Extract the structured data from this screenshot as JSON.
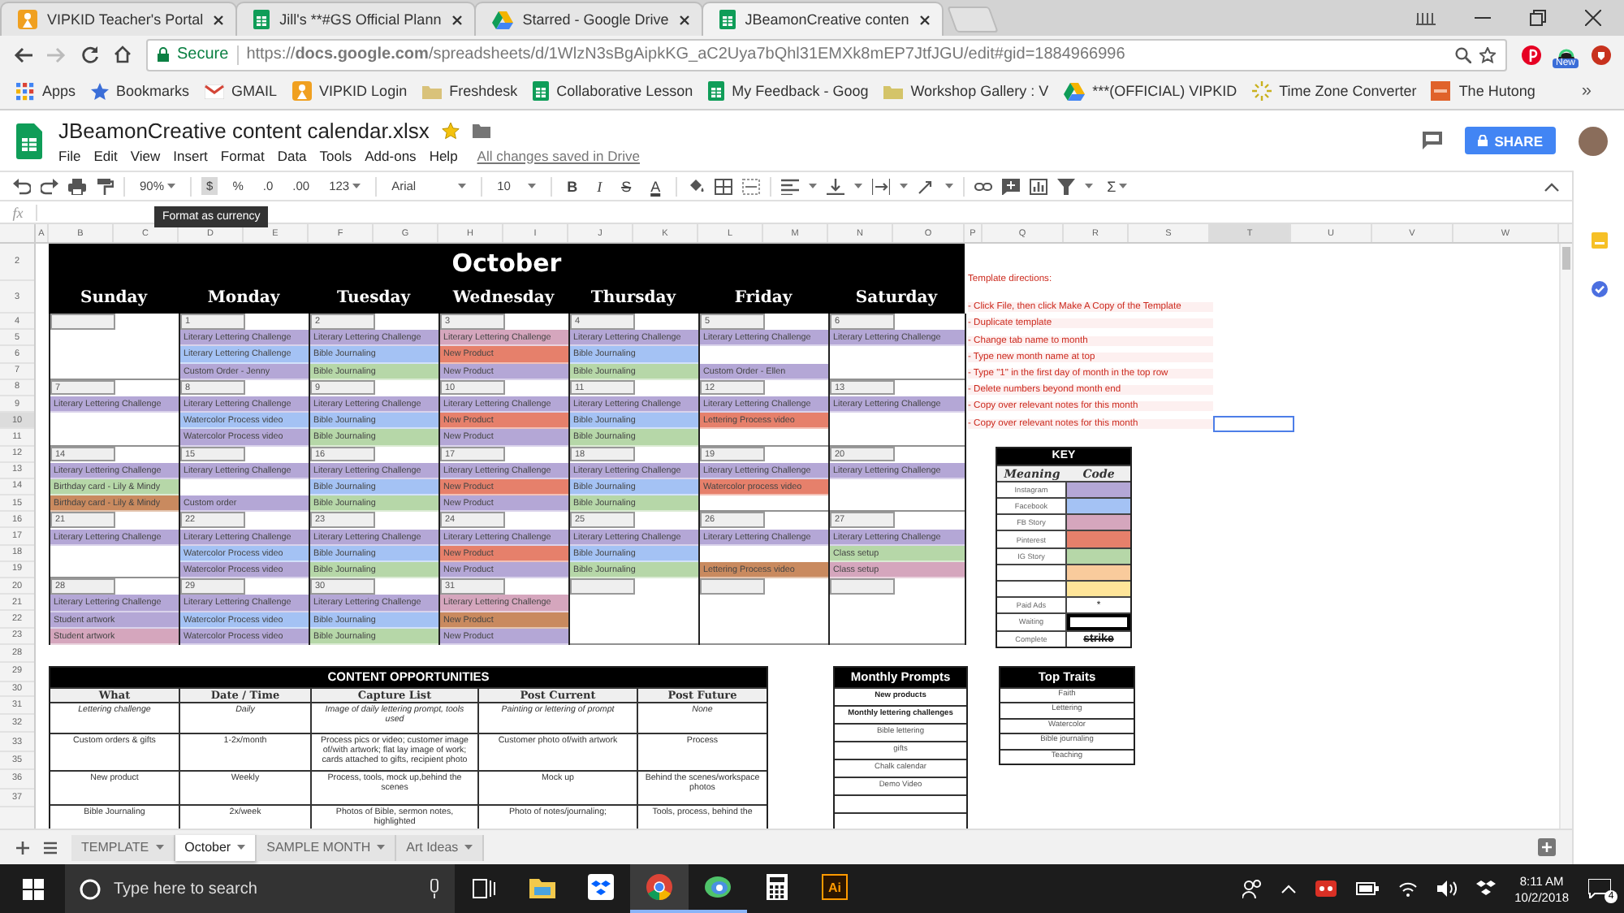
{
  "browser": {
    "tabs": [
      {
        "kind": "vipkid",
        "title": "VIPKID Teacher's Portal",
        "selected": false
      },
      {
        "kind": "sheets",
        "title": "Jill's **#GS Official Plann",
        "selected": false
      },
      {
        "kind": "drive",
        "title": "Starred - Google Drive",
        "selected": false
      },
      {
        "kind": "sheets",
        "title": "JBeamonCreative conten",
        "selected": true
      }
    ],
    "security": "Secure",
    "url": "https://**docs.google.com**/spreadsheets/d/1WlzN3sBgAipkKG_aC2Uya7bQhl31EMXk8mEP7JtfJGU/edit#gid=1884966996",
    "extension_badge": "New",
    "bookmarks": [
      {
        "kind": "apps",
        "label": "Apps"
      },
      {
        "kind": "star",
        "label": "Bookmarks"
      },
      {
        "kind": "gmail",
        "label": "GMAIL"
      },
      {
        "kind": "vipkid",
        "label": "VIPKID Login"
      },
      {
        "kind": "freshdesk",
        "label": "Freshdesk"
      },
      {
        "kind": "sheets",
        "label": "Collaborative Lesson"
      },
      {
        "kind": "sheets",
        "label": "My Feedback - Goog"
      },
      {
        "kind": "folder",
        "label": "Workshop Gallery : V"
      },
      {
        "kind": "drive",
        "label": "***(OFFICIAL) VIPKID"
      },
      {
        "kind": "sun",
        "label": "Time Zone Converter"
      },
      {
        "kind": "hutong",
        "label": "The Hutong"
      }
    ],
    "more_bookmarks": "»"
  },
  "docs": {
    "title": "JBeamonCreative content calendar.xlsx",
    "starred": true,
    "menus": [
      "File",
      "Edit",
      "View",
      "Insert",
      "Format",
      "Data",
      "Tools",
      "Add-ons",
      "Help"
    ],
    "save_status": "All changes saved in Drive",
    "share": "SHARE"
  },
  "toolbar": {
    "zoom": "90%",
    "number_formats": [
      {
        "label": "$",
        "hovered": true
      },
      {
        "label": "%",
        "hovered": false
      },
      {
        "label": ".0",
        "hovered": false
      },
      {
        "label": ".00",
        "hovered": false
      }
    ],
    "more_formats": "123",
    "font": "Arial",
    "font_size": "10",
    "text_styles": [
      "B",
      "I",
      "S",
      "A"
    ],
    "functions": "Σ",
    "tooltip": "Format as currency"
  },
  "formula_bar": {
    "label": "fx"
  },
  "columns": [
    {
      "label": "A",
      "selected": false
    },
    {
      "label": "B",
      "selected": false
    },
    {
      "label": "C",
      "selected": false
    },
    {
      "label": "D",
      "selected": false
    },
    {
      "label": "E",
      "selected": false
    },
    {
      "label": "F",
      "selected": false
    },
    {
      "label": "G",
      "selected": false
    },
    {
      "label": "H",
      "selected": false
    },
    {
      "label": "I",
      "selected": false
    },
    {
      "label": "J",
      "selected": false
    },
    {
      "label": "K",
      "selected": false
    },
    {
      "label": "L",
      "selected": false
    },
    {
      "label": "M",
      "selected": false
    },
    {
      "label": "N",
      "selected": false
    },
    {
      "label": "O",
      "selected": false
    },
    {
      "label": "P",
      "selected": false
    },
    {
      "label": "Q",
      "selected": false
    },
    {
      "label": "R",
      "selected": false
    },
    {
      "label": "S",
      "selected": false
    },
    {
      "label": "T",
      "selected": true
    },
    {
      "label": "U",
      "selected": false
    },
    {
      "label": "V",
      "selected": false
    },
    {
      "label": "W",
      "selected": false
    }
  ],
  "rows": [
    {
      "label": "2",
      "selected": false
    },
    {
      "label": "3",
      "selected": false
    },
    {
      "label": "4",
      "selected": false
    },
    {
      "label": "5",
      "selected": false
    },
    {
      "label": "6",
      "selected": false
    },
    {
      "label": "7",
      "selected": false
    },
    {
      "label": "8",
      "selected": false
    },
    {
      "label": "9",
      "selected": false
    },
    {
      "label": "10",
      "selected": true
    },
    {
      "label": "11",
      "selected": false
    },
    {
      "label": "12",
      "selected": false
    },
    {
      "label": "13",
      "selected": false
    },
    {
      "label": "14",
      "selected": false
    },
    {
      "label": "15",
      "selected": false
    },
    {
      "label": "16",
      "selected": false
    },
    {
      "label": "17",
      "selected": false
    },
    {
      "label": "18",
      "selected": false
    },
    {
      "label": "19",
      "selected": false
    },
    {
      "label": "20",
      "selected": false
    },
    {
      "label": "21",
      "selected": false
    },
    {
      "label": "22",
      "selected": false
    },
    {
      "label": "23",
      "selected": false
    },
    {
      "label": "28",
      "selected": false
    },
    {
      "label": "29",
      "selected": false
    },
    {
      "label": "30",
      "selected": false
    },
    {
      "label": "31",
      "selected": false
    },
    {
      "label": "32",
      "selected": false
    },
    {
      "label": "33",
      "selected": false
    },
    {
      "label": "35",
      "selected": false
    },
    {
      "label": "36",
      "selected": false
    },
    {
      "label": "37",
      "selected": false
    }
  ],
  "calendar": {
    "month": "October",
    "day_names": [
      "Sunday",
      "Monday",
      "Tuesday",
      "Wednesday",
      "Thursday",
      "Friday",
      "Saturday"
    ],
    "weeks": [
      {
        "days": [
          {
            "kind": "blank"
          },
          {
            "date": "1",
            "entries": [
              {
                "text": "Literary Lettering Challenge",
                "color": "#b4a7d6"
              },
              {
                "text": "Literary Lettering Challenge",
                "color": "#a4c2f4"
              },
              {
                "text": "Custom Order - Jenny",
                "color": "#b4a7d6"
              }
            ]
          },
          {
            "date": "2",
            "entries": [
              {
                "text": "Literary Lettering Challenge",
                "color": "#b4a7d6"
              },
              {
                "text": "Bible Journaling",
                "color": "#a4c2f4"
              },
              {
                "text": "Bible Journaling",
                "color": "#b6d7a8"
              }
            ]
          },
          {
            "date": "3",
            "entries": [
              {
                "text": "Literary Lettering Challenge",
                "color": "#d5a6bd"
              },
              {
                "text": "New Product",
                "color": "#e6806b"
              },
              {
                "text": "New Product",
                "color": "#b4a7d6"
              }
            ]
          },
          {
            "date": "4",
            "entries": [
              {
                "text": "Literary Lettering Challenge",
                "color": "#b4a7d6"
              },
              {
                "text": "Bible Journaling",
                "color": "#a4c2f4"
              },
              {
                "text": "Bible Journaling",
                "color": "#b6d7a8"
              }
            ]
          },
          {
            "date": "5",
            "entries": [
              {
                "text": "Literary Lettering Challenge",
                "color": "#b4a7d6"
              },
              {
                "kind": "gap"
              },
              {
                "text": "Custom Order - Ellen",
                "color": "#b4a7d6"
              }
            ]
          },
          {
            "date": "6",
            "entries": [
              {
                "text": "Literary Lettering Challenge",
                "color": "#b4a7d6"
              }
            ]
          }
        ]
      },
      {
        "days": [
          {
            "date": "7",
            "entries": [
              {
                "text": "Literary Lettering Challenge",
                "color": "#b4a7d6"
              }
            ]
          },
          {
            "date": "8",
            "entries": [
              {
                "text": "Literary Lettering Challenge",
                "color": "#b4a7d6"
              },
              {
                "text": "Watercolor Process video",
                "color": "#a4c2f4"
              },
              {
                "text": "Watercolor Process video",
                "color": "#b4a7d6"
              }
            ]
          },
          {
            "date": "9",
            "entries": [
              {
                "text": "Literary Lettering Challenge",
                "color": "#b4a7d6"
              },
              {
                "text": "Bible Journaling",
                "color": "#a4c2f4"
              },
              {
                "text": "Bible Journaling",
                "color": "#b6d7a8"
              }
            ]
          },
          {
            "date": "10",
            "entries": [
              {
                "text": "Literary Lettering Challenge",
                "color": "#b4a7d6"
              },
              {
                "text": "New Product",
                "color": "#e6806b"
              },
              {
                "text": "New Product",
                "color": "#b4a7d6"
              }
            ]
          },
          {
            "date": "11",
            "entries": [
              {
                "text": "Literary Lettering Challenge",
                "color": "#b4a7d6"
              },
              {
                "text": "Bible Journaling",
                "color": "#a4c2f4"
              },
              {
                "text": "Bible Journaling",
                "color": "#b6d7a8"
              }
            ]
          },
          {
            "date": "12",
            "entries": [
              {
                "text": "Literary Lettering Challenge",
                "color": "#b4a7d6"
              },
              {
                "text": "Lettering Process video",
                "color": "#e6806b"
              }
            ]
          },
          {
            "date": "13",
            "entries": [
              {
                "text": "Literary Lettering Challenge",
                "color": "#b4a7d6"
              }
            ]
          }
        ]
      },
      {
        "days": [
          {
            "date": "14",
            "entries": [
              {
                "text": "Literary Lettering Challenge",
                "color": "#b4a7d6"
              },
              {
                "text": "Birthday card - Lily & Mindy",
                "color": "#b6d7a8"
              },
              {
                "text": "Birthday card - Lily & Mindy",
                "color": "#c98a5f"
              }
            ]
          },
          {
            "date": "15",
            "entries": [
              {
                "text": "Literary Lettering Challenge",
                "color": "#b4a7d6"
              },
              {
                "kind": "gap"
              },
              {
                "text": "Custom order",
                "color": "#b4a7d6"
              }
            ]
          },
          {
            "date": "16",
            "entries": [
              {
                "text": "Literary Lettering Challenge",
                "color": "#b4a7d6"
              },
              {
                "text": "Bible Journaling",
                "color": "#a4c2f4"
              },
              {
                "text": "Bible Journaling",
                "color": "#b6d7a8"
              }
            ]
          },
          {
            "date": "17",
            "entries": [
              {
                "text": "Literary Lettering Challenge",
                "color": "#b4a7d6"
              },
              {
                "text": "New Product",
                "color": "#e6806b"
              },
              {
                "text": "New Product",
                "color": "#b4a7d6"
              }
            ]
          },
          {
            "date": "18",
            "entries": [
              {
                "text": "Literary Lettering Challenge",
                "color": "#b4a7d6"
              },
              {
                "text": "Bible Journaling",
                "color": "#a4c2f4"
              },
              {
                "text": "Bible Journaling",
                "color": "#b6d7a8"
              }
            ]
          },
          {
            "date": "19",
            "entries": [
              {
                "text": "Literary Lettering Challenge",
                "color": "#b4a7d6"
              },
              {
                "text": "Watercolor process video",
                "color": "#e6806b"
              }
            ]
          },
          {
            "date": "20",
            "entries": [
              {
                "text": "Literary Lettering Challenge",
                "color": "#b4a7d6"
              }
            ]
          }
        ]
      },
      {
        "days": [
          {
            "date": "21",
            "entries": [
              {
                "text": "Literary Lettering Challenge",
                "color": "#b4a7d6"
              }
            ]
          },
          {
            "date": "22",
            "entries": [
              {
                "text": "Literary Lettering Challenge",
                "color": "#b4a7d6"
              },
              {
                "text": "Watercolor Process video",
                "color": "#a4c2f4"
              },
              {
                "text": "Watercolor Process video",
                "color": "#b4a7d6"
              }
            ]
          },
          {
            "date": "23",
            "entries": [
              {
                "text": "Literary Lettering Challenge",
                "color": "#b4a7d6"
              },
              {
                "text": "Bible Journaling",
                "color": "#a4c2f4"
              },
              {
                "text": "Bible Journaling",
                "color": "#b6d7a8"
              }
            ]
          },
          {
            "date": "24",
            "entries": [
              {
                "text": "Literary Lettering Challenge",
                "color": "#b4a7d6"
              },
              {
                "text": "New Product",
                "color": "#e6806b"
              },
              {
                "text": "New Product",
                "color": "#b4a7d6"
              }
            ]
          },
          {
            "date": "25",
            "entries": [
              {
                "text": "Literary Lettering Challenge",
                "color": "#b4a7d6"
              },
              {
                "text": "Bible Journaling",
                "color": "#a4c2f4"
              },
              {
                "text": "Bible Journaling",
                "color": "#b6d7a8"
              }
            ]
          },
          {
            "date": "26",
            "entries": [
              {
                "text": "Literary Lettering Challenge",
                "color": "#b4a7d6"
              },
              {
                "kind": "gap"
              },
              {
                "text": "Lettering Process video",
                "color": "#c98a5f"
              }
            ]
          },
          {
            "date": "27",
            "entries": [
              {
                "text": "Literary Lettering Challenge",
                "color": "#b4a7d6"
              },
              {
                "text": "Class setup",
                "color": "#b6d7a8"
              },
              {
                "text": "Class setup",
                "color": "#d5a6bd"
              }
            ]
          }
        ]
      },
      {
        "days": [
          {
            "date": "28",
            "entries": [
              {
                "text": "Literary Lettering Challenge",
                "color": "#b4a7d6"
              },
              {
                "text": "Student artwork",
                "color": "#b4a7d6"
              },
              {
                "text": "Student artwork",
                "color": "#d5a6bd"
              }
            ]
          },
          {
            "date": "29",
            "entries": [
              {
                "text": "Literary Lettering Challenge",
                "color": "#b4a7d6"
              },
              {
                "text": "Watercolor Process video",
                "color": "#a4c2f4"
              },
              {
                "text": "Watercolor Process video",
                "color": "#b4a7d6"
              }
            ]
          },
          {
            "date": "30",
            "entries": [
              {
                "text": "Literary Lettering Challenge",
                "color": "#b4a7d6"
              },
              {
                "text": "Bible Journaling",
                "color": "#a4c2f4"
              },
              {
                "text": "Bible Journaling",
                "color": "#b6d7a8"
              }
            ]
          },
          {
            "date": "31",
            "entries": [
              {
                "text": "Literary Lettering Challenge",
                "color": "#d5a6bd"
              },
              {
                "text": "New Product",
                "color": "#c98a5f"
              },
              {
                "text": "New Product",
                "color": "#b4a7d6"
              }
            ]
          },
          {
            "kind": "blank"
          },
          {
            "kind": "blank"
          },
          {
            "kind": "blank"
          }
        ]
      }
    ]
  },
  "notes": {
    "heading": "Template directions:",
    "lines": [
      "- Click File, then click Make A Copy of the Template",
      "- Duplicate template",
      "- Change tab name to month",
      "- Type new month name at top",
      "- Type \"1\" in the first day of month in the top row",
      "- Delete numbers beyond month end",
      "- Copy over relevant notes for this month",
      "- Copy over relevant notes for this month"
    ]
  },
  "key": {
    "title": "KEY",
    "headers": [
      "Meaning",
      "Code"
    ],
    "rows": [
      {
        "kind": "swatch",
        "meaning": "Instagram",
        "color": "#b4a7d6"
      },
      {
        "kind": "swatch",
        "meaning": "Facebook",
        "color": "#a4c2f4"
      },
      {
        "kind": "swatch",
        "meaning": "FB Story",
        "color": "#d5a6bd"
      },
      {
        "kind": "swatch",
        "meaning": "Pinterest",
        "color": "#e6806b"
      },
      {
        "kind": "swatch",
        "meaning": "IG Story",
        "color": "#b6d7a8"
      },
      {
        "kind": "swatch",
        "color": "#f9cb9c"
      },
      {
        "kind": "swatch",
        "color": "#ffe599"
      },
      {
        "kind": "text",
        "meaning": "Paid Ads",
        "code": "*"
      },
      {
        "kind": "box",
        "meaning": "Waiting"
      },
      {
        "kind": "strike",
        "meaning": "Complete",
        "code": "strike"
      }
    ]
  },
  "content_opportunities": {
    "title": "CONTENT OPPORTUNITIES",
    "columns": [
      "What",
      "Date / Time",
      "Capture List",
      "Post Current",
      "Post Future"
    ],
    "rows": [
      {
        "italic": true,
        "cells": [
          "Lettering challenge",
          "Daily",
          "Image of daily lettering prompt, tools used",
          "Painting or lettering of prompt",
          "None"
        ]
      },
      {
        "italic": false,
        "cells": [
          "Custom orders & gifts",
          "1-2x/month",
          "Process pics or video; customer image of/with artwork; flat lay image of work; cards attached to gifts, recipient photo",
          "Customer photo of/with artwork",
          "Process"
        ]
      },
      {
        "italic": false,
        "cells": [
          "New product",
          "Weekly",
          "Process, tools, mock up,behind the scenes",
          "Mock up",
          "Behind the scenes/workspace photos"
        ]
      },
      {
        "italic": false,
        "cells": [
          "Bible Journaling",
          "2x/week",
          "Photos of Bible, sermon notes, highlighted",
          "Photo of notes/journaling;",
          "Tools, process, behind the"
        ]
      }
    ]
  },
  "monthly_prompts": {
    "title": "Monthly Prompts",
    "items": [
      {
        "text": "New products",
        "bold": true
      },
      {
        "text": "Monthly lettering challenges",
        "bold": true
      },
      {
        "text": "Bible lettering",
        "bold": false
      },
      {
        "text": "gifts",
        "bold": false
      },
      {
        "text": "Chalk calendar",
        "bold": false
      },
      {
        "text": "Demo Video",
        "bold": false
      }
    ]
  },
  "top_traits": {
    "title": "Top Traits",
    "items": [
      "Faith",
      "Lettering",
      "Watercolor",
      "Bible journaling",
      "Teaching"
    ]
  },
  "sheet_tabs": [
    {
      "label": "TEMPLATE",
      "selected": false
    },
    {
      "label": "October",
      "selected": true
    },
    {
      "label": "SAMPLE MONTH",
      "selected": false
    },
    {
      "label": "Art Ideas",
      "selected": false
    }
  ],
  "taskbar": {
    "search_placeholder": "Type here to search",
    "apps": [
      {
        "kind": "explorer",
        "selected": false,
        "running": false
      },
      {
        "kind": "dropbox",
        "selected": false,
        "running": false
      },
      {
        "kind": "chrome",
        "selected": true,
        "running": true
      },
      {
        "kind": "messenger",
        "selected": false,
        "running": true
      },
      {
        "kind": "calculator",
        "selected": false,
        "running": false
      },
      {
        "kind": "illustrator",
        "label": "Ai",
        "selected": false,
        "running": false
      }
    ],
    "time": "8:11 AM",
    "date": "10/2/2018",
    "notification_count": "4"
  }
}
